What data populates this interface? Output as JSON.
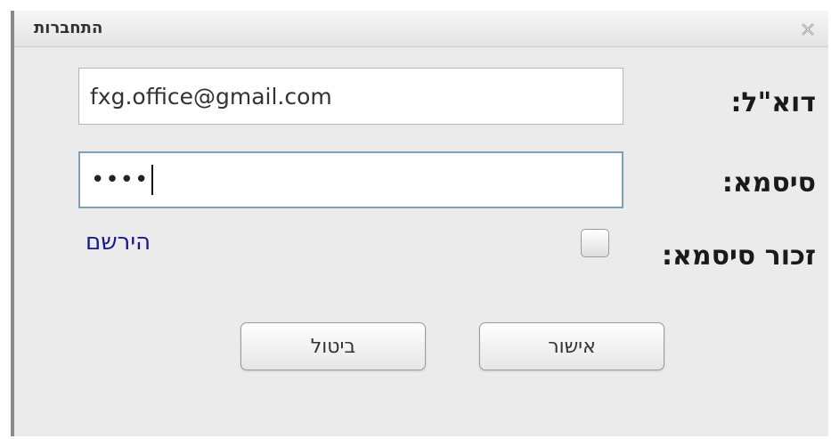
{
  "window": {
    "title": "התחברות"
  },
  "form": {
    "email_label": "דוא\"ל:",
    "email_value": "fxg.office@gmail.com",
    "password_label": "סיסמא:",
    "password_masked": "••••",
    "remember_label": "זכור סיסמא:",
    "remember_checked": false,
    "register_link": "הירשם"
  },
  "buttons": {
    "ok_label": "אישור",
    "cancel_label": "ביטול"
  },
  "icons": {
    "close": "close-icon"
  }
}
